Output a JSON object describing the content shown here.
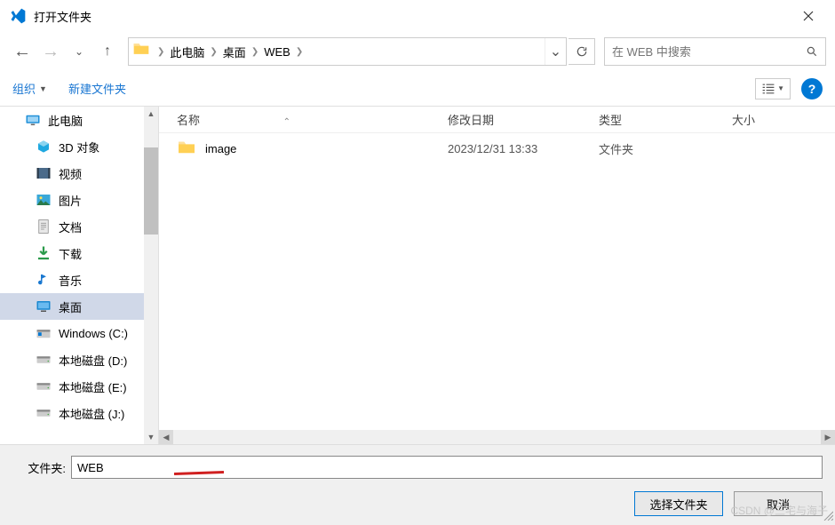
{
  "dialog": {
    "title": "打开文件夹"
  },
  "breadcrumb": {
    "items": [
      "此电脑",
      "桌面",
      "WEB"
    ]
  },
  "search": {
    "placeholder": "在 WEB 中搜索"
  },
  "toolbar": {
    "organize": "组织",
    "new_folder": "新建文件夹"
  },
  "columns": {
    "name": "名称",
    "modified": "修改日期",
    "type": "类型",
    "size": "大小"
  },
  "sidebar": {
    "items": [
      {
        "label": "此电脑",
        "icon": "pc",
        "level": 1,
        "selected": false
      },
      {
        "label": "3D 对象",
        "icon": "3d",
        "level": 2,
        "selected": false
      },
      {
        "label": "视频",
        "icon": "video",
        "level": 2,
        "selected": false
      },
      {
        "label": "图片",
        "icon": "picture",
        "level": 2,
        "selected": false
      },
      {
        "label": "文档",
        "icon": "doc",
        "level": 2,
        "selected": false
      },
      {
        "label": "下载",
        "icon": "download",
        "level": 2,
        "selected": false
      },
      {
        "label": "音乐",
        "icon": "music",
        "level": 2,
        "selected": false
      },
      {
        "label": "桌面",
        "icon": "desktop",
        "level": 2,
        "selected": true
      },
      {
        "label": "Windows (C:)",
        "icon": "winc",
        "level": 2,
        "selected": false
      },
      {
        "label": "本地磁盘 (D:)",
        "icon": "disk",
        "level": 2,
        "selected": false
      },
      {
        "label": "本地磁盘 (E:)",
        "icon": "disk",
        "level": 2,
        "selected": false
      },
      {
        "label": "本地磁盘 (J:)",
        "icon": "disk",
        "level": 2,
        "selected": false
      }
    ]
  },
  "files": [
    {
      "name": "image",
      "date": "2023/12/31 13:33",
      "type": "文件夹"
    }
  ],
  "footer": {
    "folder_label": "文件夹:",
    "folder_value": "WEB",
    "select_button": "选择文件夹",
    "cancel_button": "取消"
  },
  "watermark": "CSDN @三宅与海子"
}
